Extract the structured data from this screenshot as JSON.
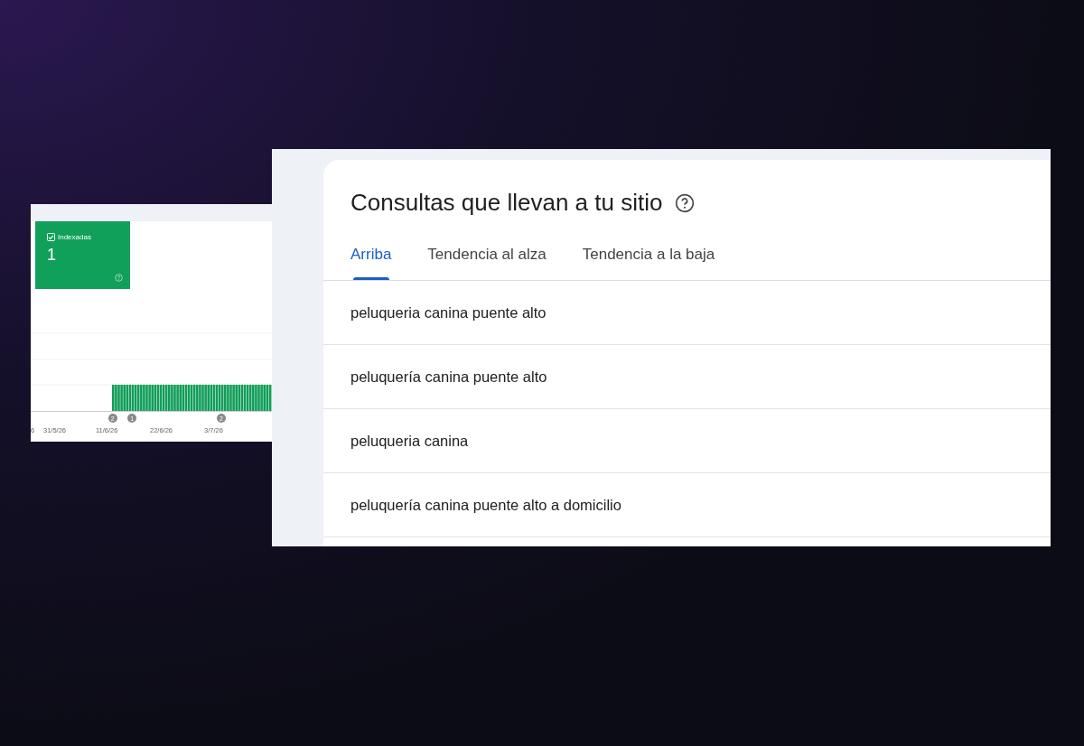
{
  "coverage_panel": {
    "status_card": {
      "checked": true,
      "label": "Indexadas",
      "count": "1"
    },
    "chart_markers": [
      "2",
      "1",
      "2"
    ],
    "x_axis_labels": [
      "6",
      "31/5/26",
      "11/6/26",
      "22/6/26",
      "3/7/26"
    ]
  },
  "queries_panel": {
    "title": "Consultas que llevan a tu sitio",
    "tabs": [
      {
        "label": "Arriba",
        "selected": true
      },
      {
        "label": "Tendencia al alza",
        "selected": false
      },
      {
        "label": "Tendencia a la baja",
        "selected": false
      }
    ],
    "rows": [
      "peluqueria canina puente alto",
      "peluquería canina puente alto",
      "peluqueria canina",
      "peluquería canina puente alto a domicilio"
    ]
  }
}
